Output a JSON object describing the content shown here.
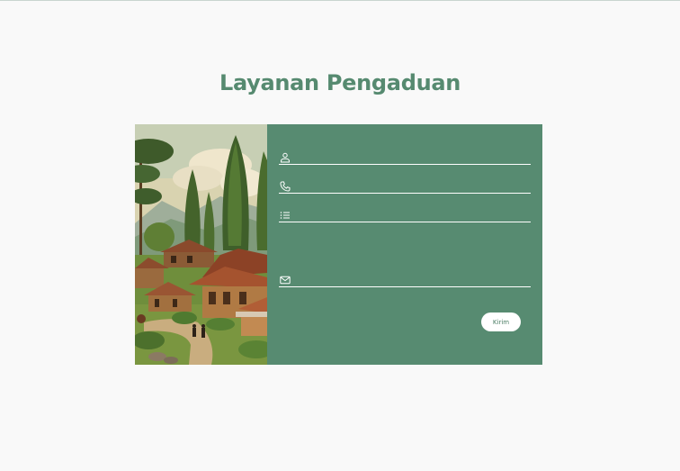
{
  "page": {
    "title": "Layanan Pengaduan"
  },
  "form": {
    "fields": [
      {
        "icon": "person-icon",
        "value": "",
        "placeholder": ""
      },
      {
        "icon": "phone-icon",
        "value": "",
        "placeholder": ""
      },
      {
        "icon": "list-icon",
        "value": "",
        "placeholder": ""
      },
      {
        "icon": "mail-icon",
        "value": "",
        "placeholder": ""
      }
    ],
    "submit_label": "Kirim"
  },
  "illustration": {
    "description_icon": "village-illustration"
  },
  "colors": {
    "accent": "#578b71",
    "title": "#568a70",
    "background": "#f9f9f9",
    "button_text": "#4d7f66"
  }
}
